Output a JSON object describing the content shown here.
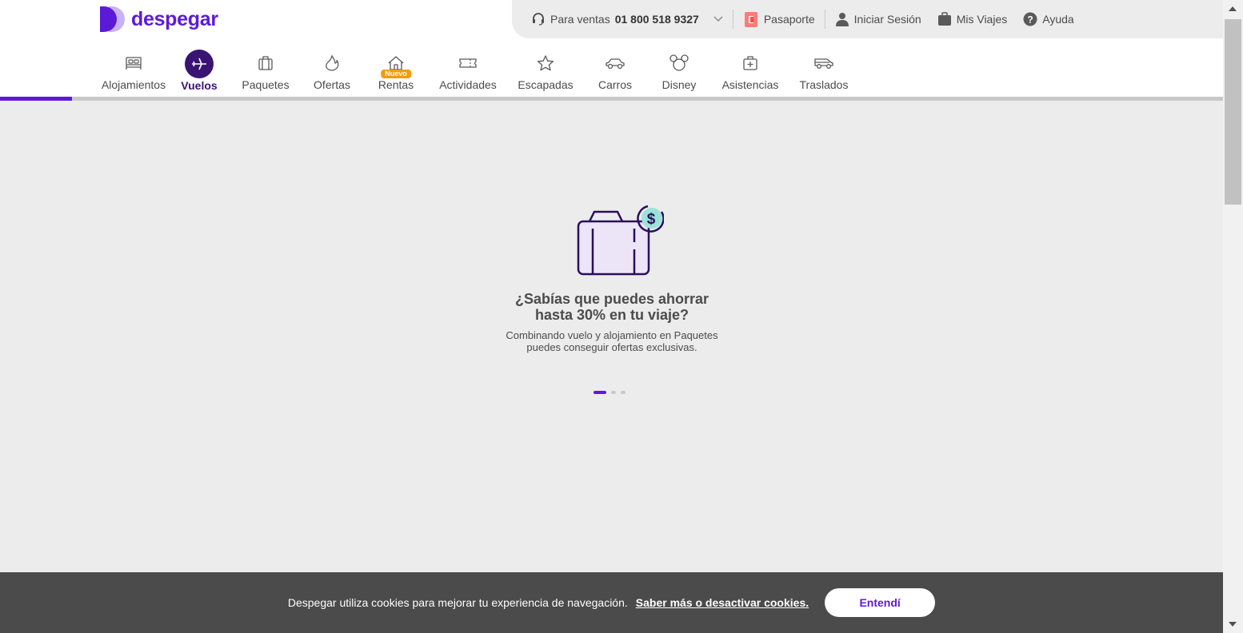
{
  "brand": {
    "name": "despegar",
    "color": "#5c1ad8"
  },
  "topbar": {
    "sales_prefix": "Para ventas",
    "sales_phone": "01 800 518 9327",
    "passport": "Pasaporte",
    "login": "Iniciar Sesión",
    "trips": "Mis Viajes",
    "help": "Ayuda"
  },
  "nav": {
    "items": [
      {
        "label": "Alojamientos",
        "icon": "bed-icon"
      },
      {
        "label": "Vuelos",
        "icon": "plane-icon",
        "active": true
      },
      {
        "label": "Paquetes",
        "icon": "suitcase-icon"
      },
      {
        "label": "Ofertas",
        "icon": "flame-icon"
      },
      {
        "label": "Rentas",
        "icon": "house-icon",
        "badge": "Nuevo"
      },
      {
        "label": "Actividades",
        "icon": "ticket-icon"
      },
      {
        "label": "Escapadas",
        "icon": "star-icon"
      },
      {
        "label": "Carros",
        "icon": "car-icon"
      },
      {
        "label": "Disney",
        "icon": "mickey-icon"
      },
      {
        "label": "Asistencias",
        "icon": "medical-kit-icon"
      },
      {
        "label": "Traslados",
        "icon": "shuttle-icon"
      }
    ],
    "badge_color": "#f39a11",
    "active_color": "#3a1472"
  },
  "promo": {
    "title_line1": "¿Sabías que puedes ahorrar",
    "title_line2": "hasta 30% en tu viaje?",
    "text_line1": "Combinando vuelo y alojamiento en Paquetes",
    "text_line2": "puedes conseguir ofertas exclusivas.",
    "accent": "#9be3d9"
  },
  "carousel": {
    "count": 3,
    "active_index": 0
  },
  "cookie": {
    "text": "Despegar utiliza cookies para mejorar tu experiencia de navegación.",
    "link": "Saber más o desactivar cookies.",
    "button": "Entendí"
  }
}
